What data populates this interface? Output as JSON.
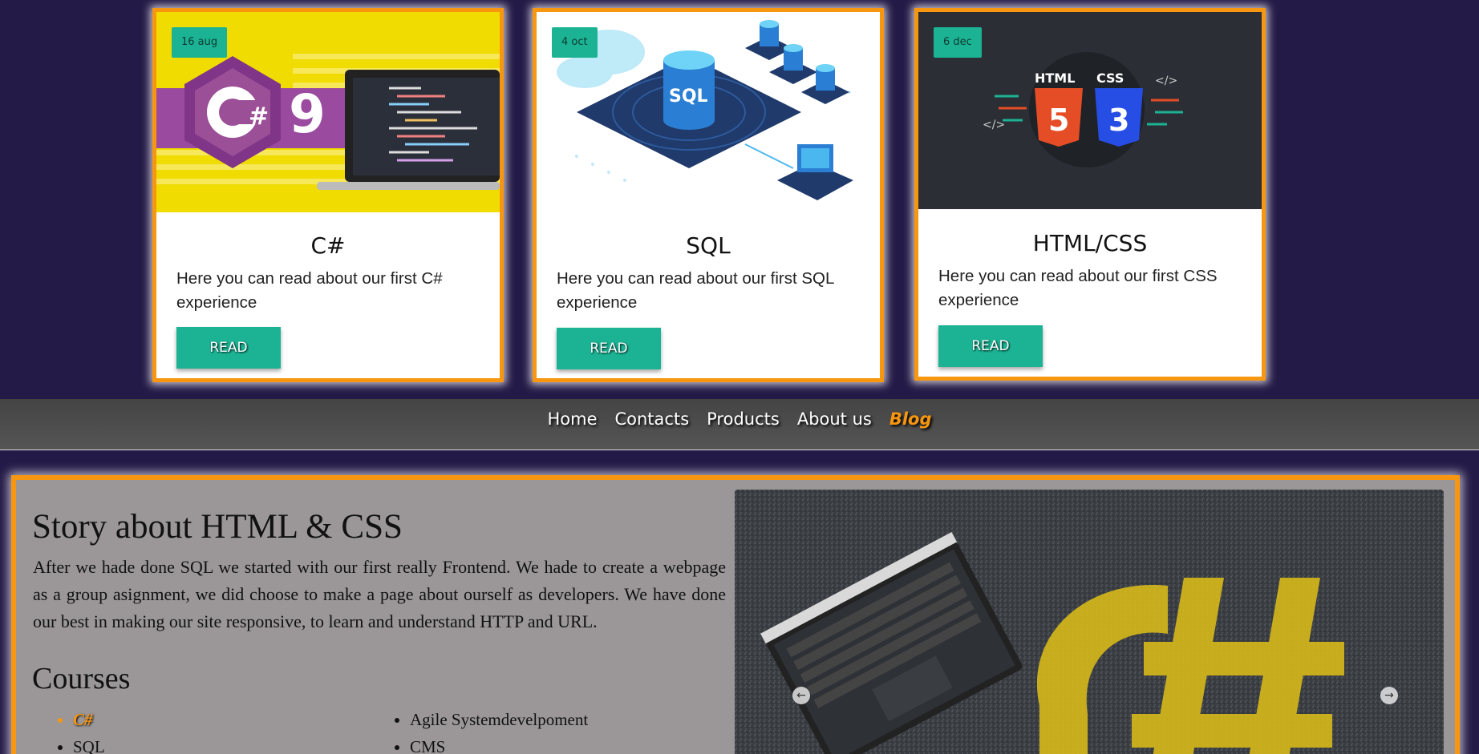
{
  "cards": [
    {
      "date": "16 aug",
      "title": "C#",
      "description": "Here you can read about our first C# experience",
      "button": "READ",
      "image_icon": "csharp-9-laptop-image"
    },
    {
      "date": "4 oct",
      "title": "SQL",
      "description": "Here you can read about our first SQL experience",
      "button": "READ",
      "image_icon": "sql-database-image"
    },
    {
      "date": "6 dec",
      "title": "HTML/CSS",
      "description": "Here you can read about our first CSS experience",
      "button": "READ",
      "image_icon": "html5-css3-image"
    }
  ],
  "nav": {
    "items": [
      "Home",
      "Contacts",
      "Products",
      "About us",
      "Blog"
    ],
    "active": "Blog"
  },
  "story": {
    "title": "Story about HTML & CSS",
    "paragraph": "After we hade done SQL we started with our first really Frontend. We hade to create a webpage as a group asignment, we did choose to make a page about ourself as developers. We have done our best in making our site responsive, to learn and understand HTTP and URL.",
    "courses_title": "Courses",
    "courses": [
      "C#",
      "SQL",
      "Agile Systemdevelpoment",
      "CMS"
    ],
    "highlighted_course": "C#",
    "slider": {
      "prev_icon": "arrow-left-icon",
      "next_icon": "arrow-right-icon",
      "image_icon": "laptop-csharp-asphalt-image"
    }
  },
  "colors": {
    "background": "#241a47",
    "accent_orange": "#f7960f",
    "teal": "#1bb394",
    "nav_bg": "#4a4a4a",
    "section_bg": "#9b9799"
  }
}
